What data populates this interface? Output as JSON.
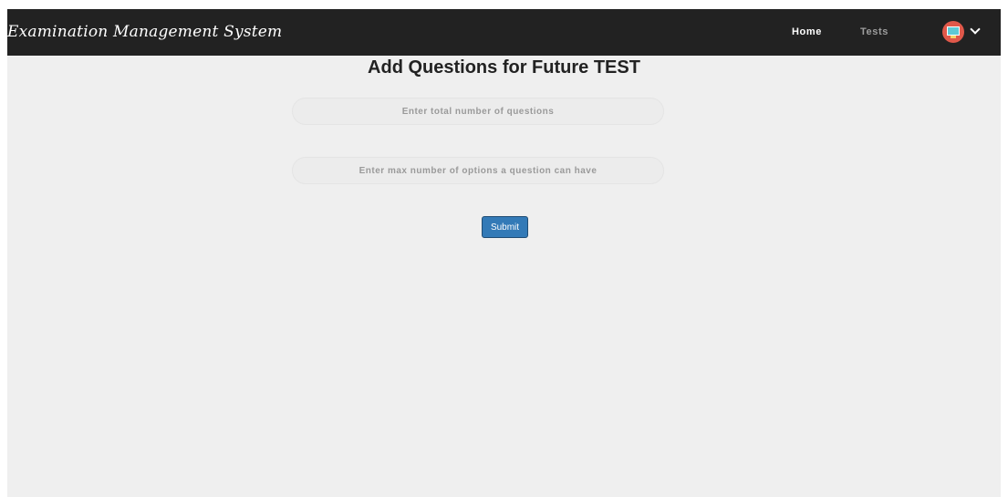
{
  "navbar": {
    "brand": "Examination Management System",
    "links": [
      {
        "label": "Home",
        "active": true
      },
      {
        "label": "Tests",
        "active": false
      }
    ],
    "user_menu": {
      "avatar_icon": "user-avatar-icon",
      "dropdown_icon": "chevron-down-icon"
    }
  },
  "main": {
    "title": "Add Questions for Future TEST",
    "questions_input": {
      "placeholder": "Enter total number of questions",
      "value": ""
    },
    "options_input": {
      "placeholder": "Enter max number of options a question can have",
      "value": ""
    },
    "submit_label": "Submit"
  },
  "colors": {
    "navbar_bg": "#222222",
    "page_bg": "#efefef",
    "submit_bg": "#337ab7",
    "avatar_bg": "#e0584a"
  }
}
